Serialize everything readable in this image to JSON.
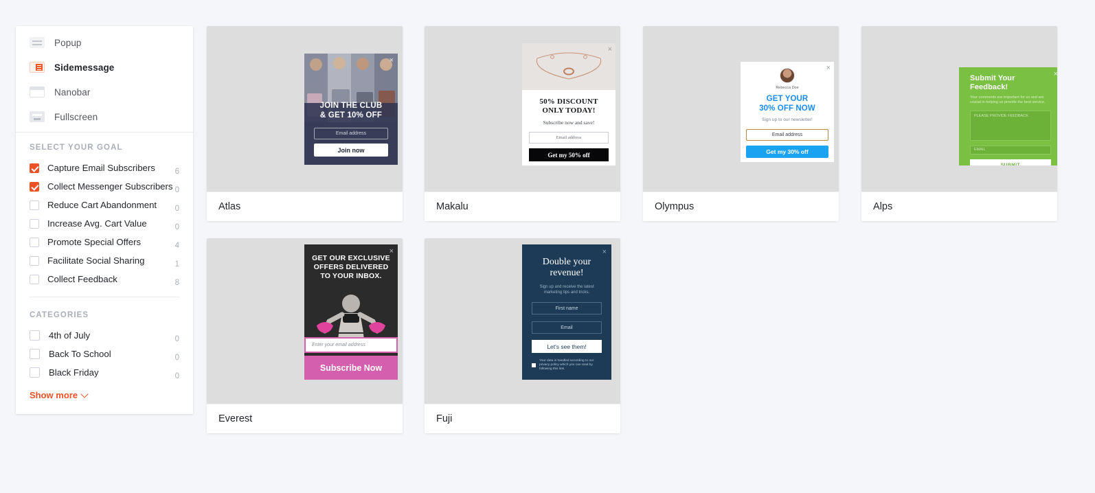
{
  "sidebar": {
    "types": [
      {
        "label": "Popup",
        "icon": "popup-icon",
        "active": false
      },
      {
        "label": "Sidemessage",
        "icon": "sidemessage-icon",
        "active": true
      },
      {
        "label": "Nanobar",
        "icon": "nanobar-icon",
        "active": false
      },
      {
        "label": "Fullscreen",
        "icon": "fullscreen-icon",
        "active": false
      }
    ],
    "goal_section_title": "SELECT YOUR GOAL",
    "goals": [
      {
        "label": "Capture Email Subscribers",
        "count": "6",
        "checked": true
      },
      {
        "label": "Collect Messenger Subscribers",
        "count": "0",
        "checked": true
      },
      {
        "label": "Reduce Cart Abandonment",
        "count": "0",
        "checked": false
      },
      {
        "label": "Increase Avg. Cart Value",
        "count": "0",
        "checked": false
      },
      {
        "label": "Promote Special Offers",
        "count": "4",
        "checked": false
      },
      {
        "label": "Facilitate Social Sharing",
        "count": "1",
        "checked": false
      },
      {
        "label": "Collect Feedback",
        "count": "8",
        "checked": false
      }
    ],
    "categories_title": "CATEGORIES",
    "categories": [
      {
        "label": "4th of July",
        "count": "0",
        "checked": false
      },
      {
        "label": "Back To School",
        "count": "0",
        "checked": false
      },
      {
        "label": "Black Friday",
        "count": "0",
        "checked": false
      }
    ],
    "show_more": "Show more"
  },
  "accent_color": "#ef5126",
  "close_glyph": "×",
  "cards": {
    "atlas": {
      "name": "Atlas",
      "headline_1": "JOIN THE CLUB",
      "headline_2": "& GET 10% OFF",
      "input_placeholder": "Email address",
      "button": "Join now"
    },
    "makalu": {
      "name": "Makalu",
      "headline_1": "50% DISCOUNT",
      "headline_2": "ONLY TODAY!",
      "subtitle": "Subscribe now and save!",
      "input_placeholder": "Email address",
      "button": "Get my 50% off"
    },
    "olympus": {
      "name": "Olympus",
      "avatar_name": "Rebecca Doe",
      "headline_1": "GET YOUR",
      "headline_2": "30% OFF NOW",
      "subtitle": "Sign up to our newsletter!",
      "input_placeholder": "Email address",
      "button": "Get my 30% off"
    },
    "alps": {
      "name": "Alps",
      "headline_1": "Submit Your",
      "headline_2": "Feedback!",
      "subtitle": "Your comments are important for us and are crucial in helping us provide the best service.",
      "textarea_placeholder": "PLEASE PROVIDE FEEDBACK",
      "input_placeholder": "EMAIL",
      "button": "SUBMIT"
    },
    "everest": {
      "name": "Everest",
      "headline_1": "GET OUR EXCLUSIVE",
      "headline_2": "OFFERS DELIVERED",
      "headline_3": "TO YOUR INBOX.",
      "input_placeholder": "Enter your email address",
      "button": "Subscribe Now"
    },
    "fuji": {
      "name": "Fuji",
      "headline_1": "Double your",
      "headline_2": "revenue!",
      "subtitle": "Sign up and receive the latest marketing tips and tricks.",
      "input_1_placeholder": "First name",
      "input_2_placeholder": "Email",
      "button": "Let's see them!",
      "privacy_text": "Your data is handled according to our privacy policy which you can read by following this link."
    }
  }
}
